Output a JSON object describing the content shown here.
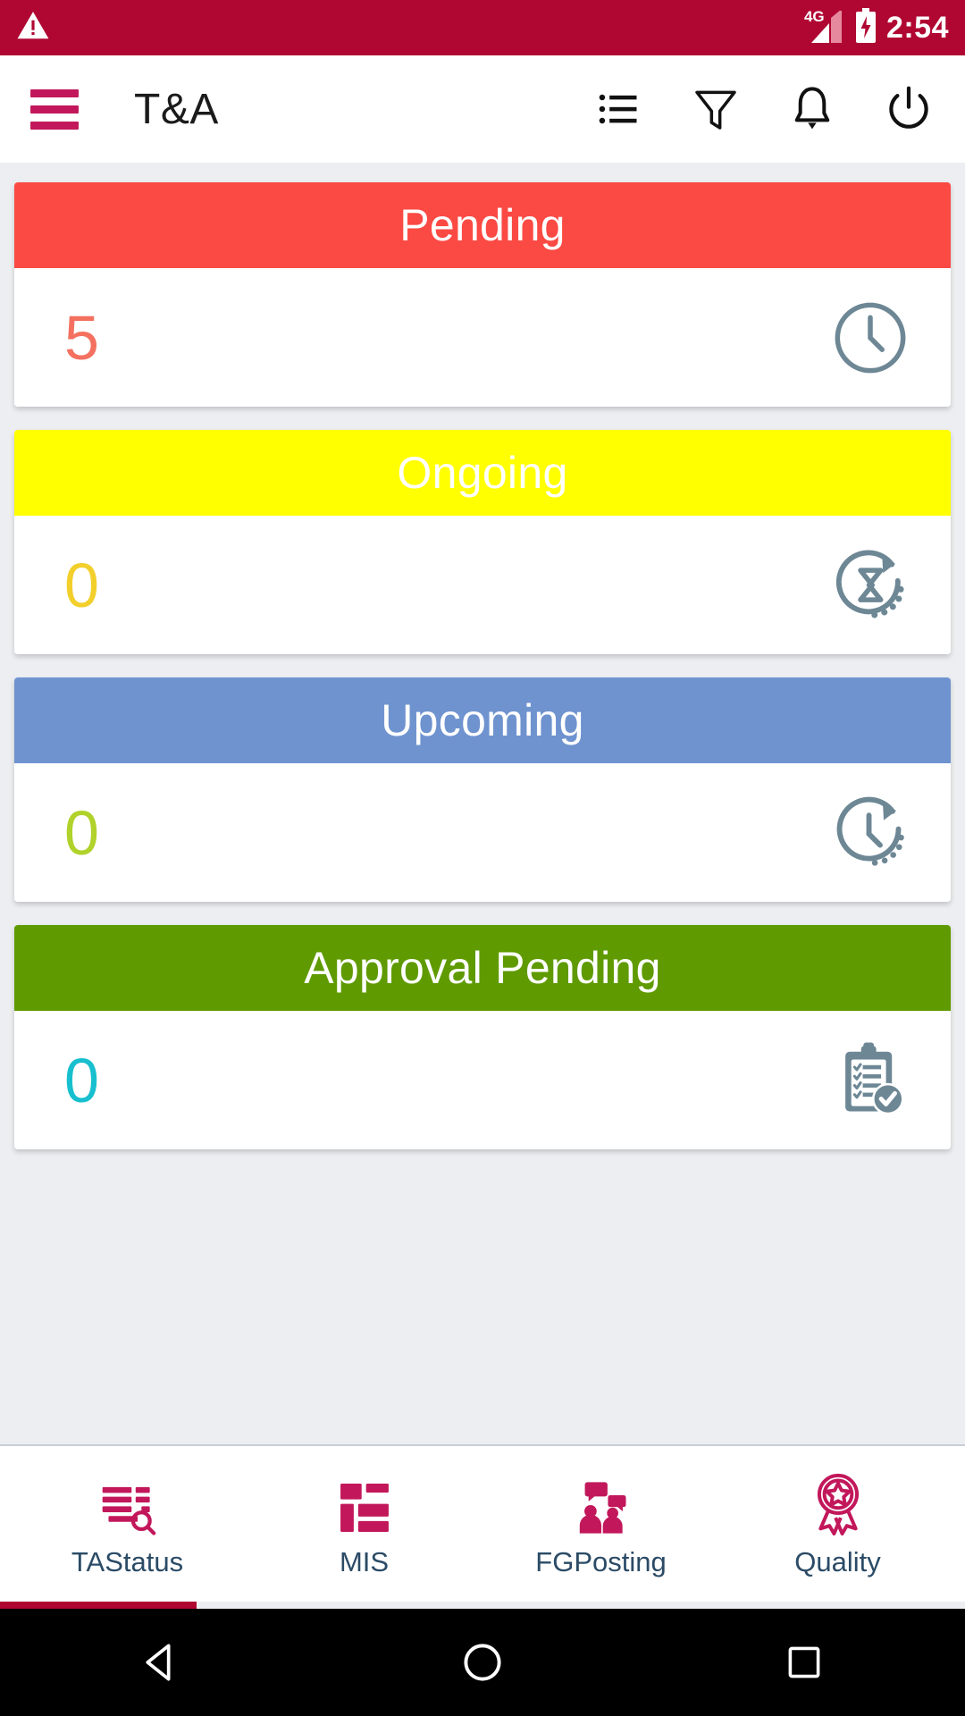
{
  "status_bar": {
    "warning_icon": "warning-triangle-icon",
    "network_type": "4G",
    "signal_icon": "signal-bars-icon",
    "battery_icon": "battery-charging-icon",
    "time": "2:54",
    "background_color": "#b00632",
    "text_color": "#ffffff"
  },
  "app_bar": {
    "menu_icon": "hamburger-menu-icon",
    "menu_color": "#c2185b",
    "title": "T&A",
    "actions": [
      {
        "name": "list-icon",
        "label": "List"
      },
      {
        "name": "filter-icon",
        "label": "Filter"
      },
      {
        "name": "notification-bell-icon",
        "label": "Notifications"
      },
      {
        "name": "power-icon",
        "label": "Power"
      }
    ]
  },
  "cards": [
    {
      "title": "Pending",
      "count": "5",
      "header_color": "#fb4a43",
      "count_color": "#f4705f",
      "icon": "clock-icon",
      "icon_color": "#6d8795"
    },
    {
      "title": "Ongoing",
      "count": "0",
      "header_color": "#ffff00",
      "count_color": "#f2cf2b",
      "icon": "hourglass-refresh-icon",
      "icon_color": "#6d8795"
    },
    {
      "title": "Upcoming",
      "count": "0",
      "header_color": "#6f93cf",
      "count_color": "#b0d22a",
      "icon": "clock-arrow-icon",
      "icon_color": "#6d8795"
    },
    {
      "title": "Approval Pending",
      "count": "0",
      "header_color": "#5f9a00",
      "count_color": "#18bfce",
      "icon": "clipboard-check-icon",
      "icon_color": "#6d8795"
    }
  ],
  "bottom_nav": {
    "items": [
      {
        "label": "TAStatus",
        "icon": "ta-status-icon"
      },
      {
        "label": "MIS",
        "icon": "mis-grid-icon"
      },
      {
        "label": "FGPosting",
        "icon": "fg-posting-icon"
      },
      {
        "label": "Quality",
        "icon": "quality-ribbon-icon"
      }
    ],
    "icon_color": "#c2185b",
    "label_color": "#2b4b66",
    "active_index": 3
  },
  "system_nav": {
    "back": "back-triangle-icon",
    "home": "home-circle-icon",
    "recents": "recents-square-icon"
  }
}
